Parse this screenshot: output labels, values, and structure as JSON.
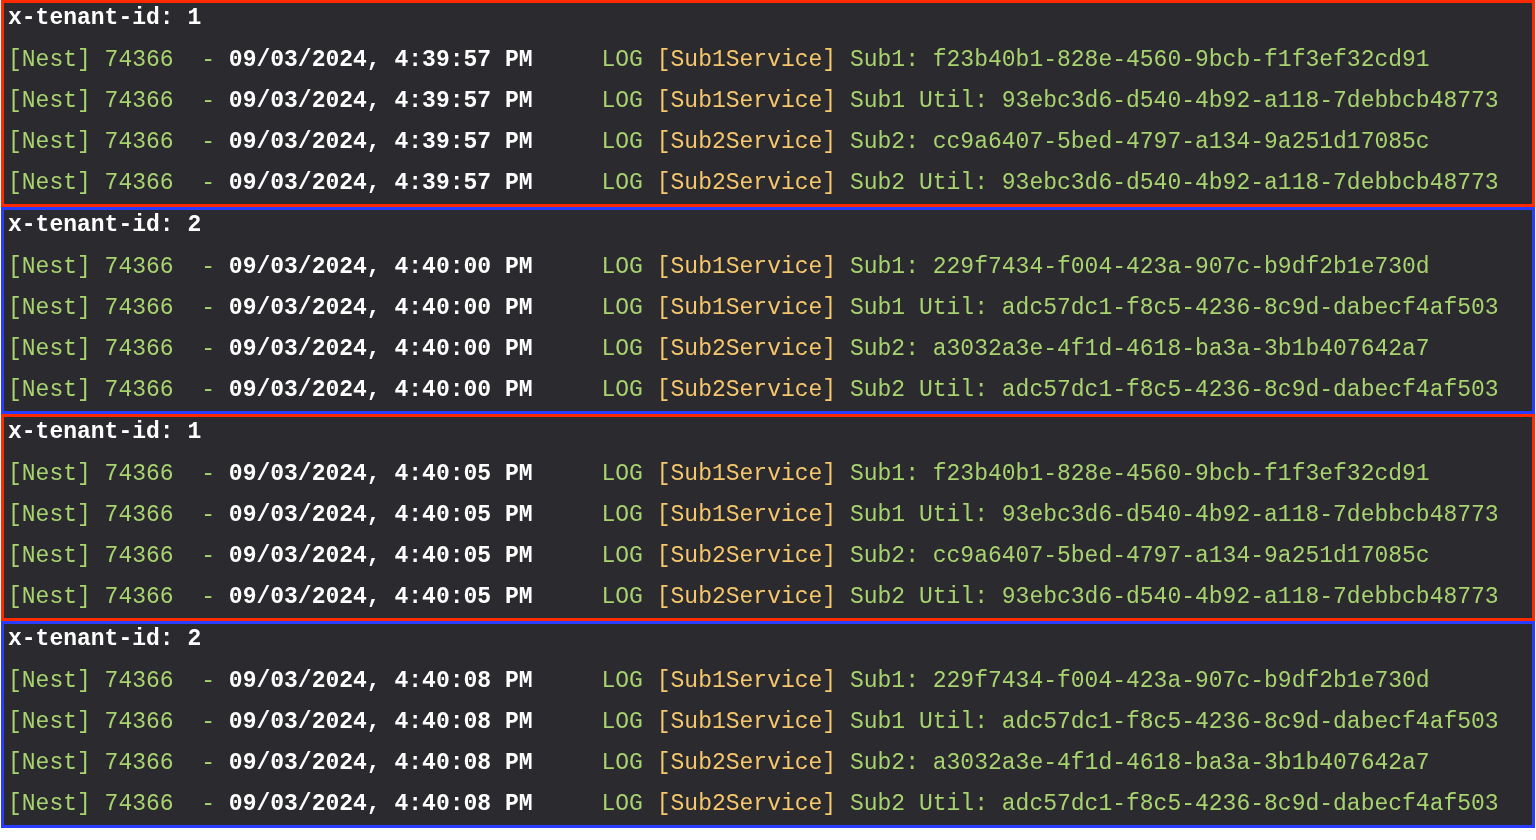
{
  "blocks": [
    {
      "header": "x-tenant-id: 1",
      "color": "#ff2a00",
      "lines": [
        {
          "prefix": "[Nest] 74366  -",
          "timestamp": "09/03/2024, 4:39:57 PM",
          "level": "LOG",
          "context": "[Sub1Service]",
          "message": "Sub1: f23b40b1-828e-4560-9bcb-f1f3ef32cd91"
        },
        {
          "prefix": "[Nest] 74366  -",
          "timestamp": "09/03/2024, 4:39:57 PM",
          "level": "LOG",
          "context": "[Sub1Service]",
          "message": "Sub1 Util: 93ebc3d6-d540-4b92-a118-7debbcb48773"
        },
        {
          "prefix": "[Nest] 74366  -",
          "timestamp": "09/03/2024, 4:39:57 PM",
          "level": "LOG",
          "context": "[Sub2Service]",
          "message": "Sub2: cc9a6407-5bed-4797-a134-9a251d17085c"
        },
        {
          "prefix": "[Nest] 74366  -",
          "timestamp": "09/03/2024, 4:39:57 PM",
          "level": "LOG",
          "context": "[Sub2Service]",
          "message": "Sub2 Util: 93ebc3d6-d540-4b92-a118-7debbcb48773"
        }
      ]
    },
    {
      "header": "x-tenant-id: 2",
      "color": "#2a3cff",
      "lines": [
        {
          "prefix": "[Nest] 74366  -",
          "timestamp": "09/03/2024, 4:40:00 PM",
          "level": "LOG",
          "context": "[Sub1Service]",
          "message": "Sub1: 229f7434-f004-423a-907c-b9df2b1e730d"
        },
        {
          "prefix": "[Nest] 74366  -",
          "timestamp": "09/03/2024, 4:40:00 PM",
          "level": "LOG",
          "context": "[Sub1Service]",
          "message": "Sub1 Util: adc57dc1-f8c5-4236-8c9d-dabecf4af503"
        },
        {
          "prefix": "[Nest] 74366  -",
          "timestamp": "09/03/2024, 4:40:00 PM",
          "level": "LOG",
          "context": "[Sub2Service]",
          "message": "Sub2: a3032a3e-4f1d-4618-ba3a-3b1b407642a7"
        },
        {
          "prefix": "[Nest] 74366  -",
          "timestamp": "09/03/2024, 4:40:00 PM",
          "level": "LOG",
          "context": "[Sub2Service]",
          "message": "Sub2 Util: adc57dc1-f8c5-4236-8c9d-dabecf4af503"
        }
      ]
    },
    {
      "header": "x-tenant-id: 1",
      "color": "#ff2a00",
      "lines": [
        {
          "prefix": "[Nest] 74366  -",
          "timestamp": "09/03/2024, 4:40:05 PM",
          "level": "LOG",
          "context": "[Sub1Service]",
          "message": "Sub1: f23b40b1-828e-4560-9bcb-f1f3ef32cd91"
        },
        {
          "prefix": "[Nest] 74366  -",
          "timestamp": "09/03/2024, 4:40:05 PM",
          "level": "LOG",
          "context": "[Sub1Service]",
          "message": "Sub1 Util: 93ebc3d6-d540-4b92-a118-7debbcb48773"
        },
        {
          "prefix": "[Nest] 74366  -",
          "timestamp": "09/03/2024, 4:40:05 PM",
          "level": "LOG",
          "context": "[Sub2Service]",
          "message": "Sub2: cc9a6407-5bed-4797-a134-9a251d17085c"
        },
        {
          "prefix": "[Nest] 74366  -",
          "timestamp": "09/03/2024, 4:40:05 PM",
          "level": "LOG",
          "context": "[Sub2Service]",
          "message": "Sub2 Util: 93ebc3d6-d540-4b92-a118-7debbcb48773"
        }
      ]
    },
    {
      "header": "x-tenant-id: 2",
      "color": "#2a3cff",
      "lines": [
        {
          "prefix": "[Nest] 74366  -",
          "timestamp": "09/03/2024, 4:40:08 PM",
          "level": "LOG",
          "context": "[Sub1Service]",
          "message": "Sub1: 229f7434-f004-423a-907c-b9df2b1e730d"
        },
        {
          "prefix": "[Nest] 74366  -",
          "timestamp": "09/03/2024, 4:40:08 PM",
          "level": "LOG",
          "context": "[Sub1Service]",
          "message": "Sub1 Util: adc57dc1-f8c5-4236-8c9d-dabecf4af503"
        },
        {
          "prefix": "[Nest] 74366  -",
          "timestamp": "09/03/2024, 4:40:08 PM",
          "level": "LOG",
          "context": "[Sub2Service]",
          "message": "Sub2: a3032a3e-4f1d-4618-ba3a-3b1b407642a7"
        },
        {
          "prefix": "[Nest] 74366  -",
          "timestamp": "09/03/2024, 4:40:08 PM",
          "level": "LOG",
          "context": "[Sub2Service]",
          "message": "Sub2 Util: adc57dc1-f8c5-4236-8c9d-dabecf4af503"
        }
      ]
    }
  ]
}
